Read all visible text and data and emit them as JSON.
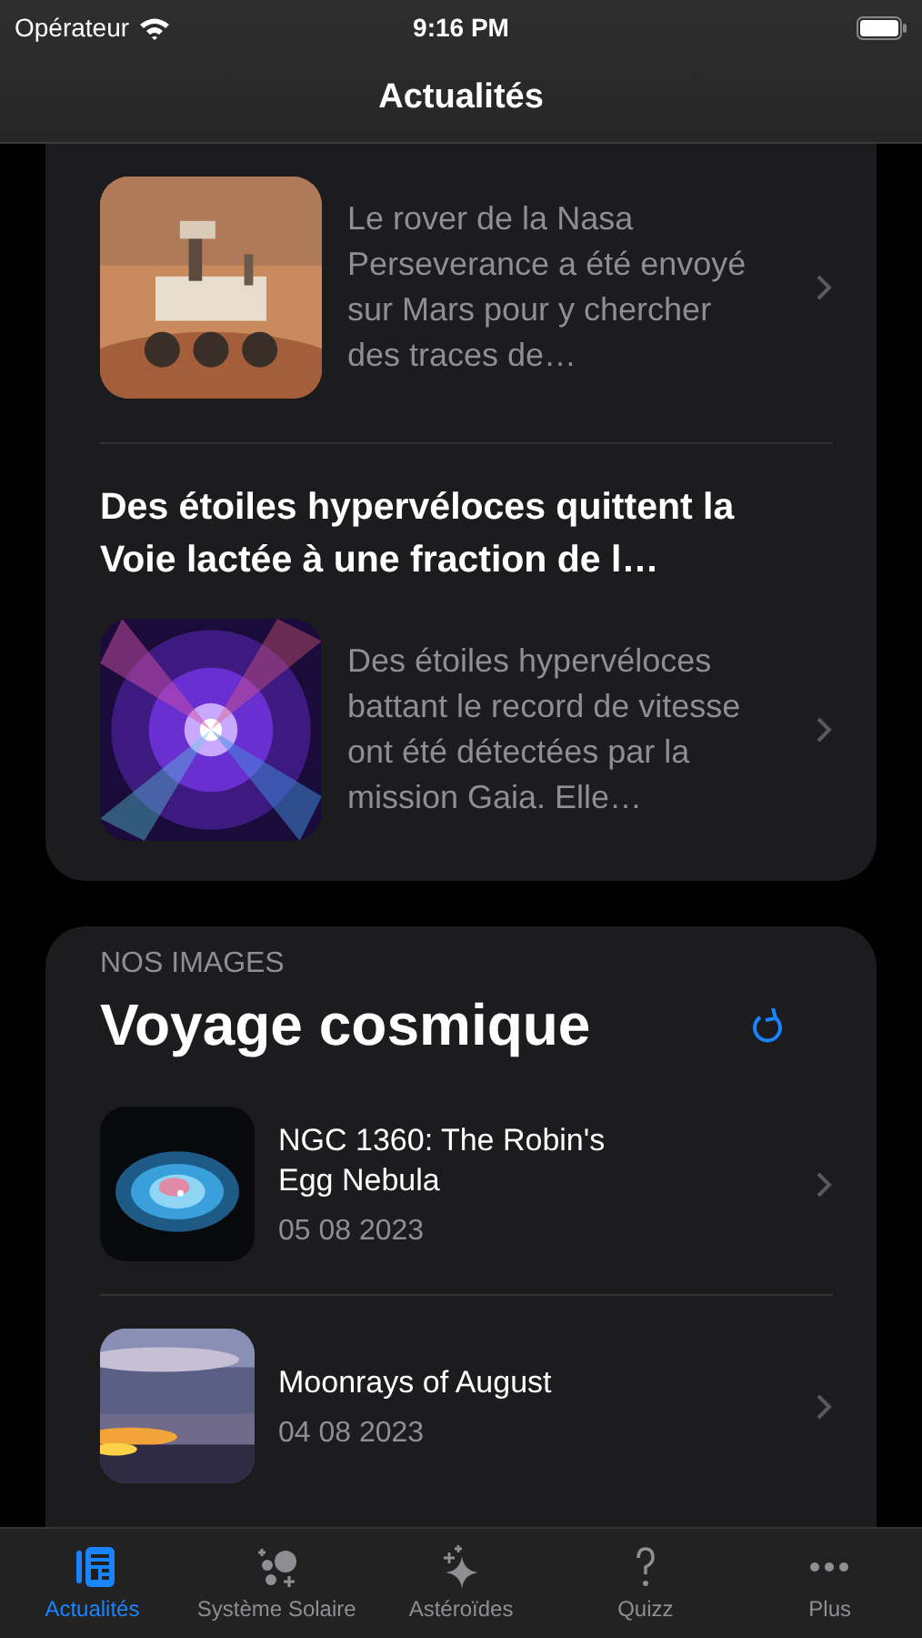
{
  "status_bar": {
    "carrier": "Opérateur",
    "time": "9:16 PM"
  },
  "nav": {
    "title": "Actualités"
  },
  "news": [
    {
      "summary": "Le rover de la Nasa Perseverance a été envoyé sur Mars pour y chercher des traces de…"
    },
    {
      "headline": "Des étoiles hypervéloces quittent la Voie lactée à une fraction de l…",
      "summary": "Des étoiles hypervéloces battant le record de vitesse ont été détectées par la mission Gaia. Elle…"
    }
  ],
  "images": {
    "overline": "NOS IMAGES",
    "title": "Voyage cosmique",
    "items": [
      {
        "title": "NGC 1360: The Robin's Egg Nebula",
        "date": "05 08 2023"
      },
      {
        "title": "Moonrays of August",
        "date": "04 08 2023"
      }
    ]
  },
  "tabs": [
    {
      "label": "Actualités",
      "selected": true
    },
    {
      "label": "Système Solaire",
      "selected": false
    },
    {
      "label": "Astéroïdes",
      "selected": false
    },
    {
      "label": "Quizz",
      "selected": false
    },
    {
      "label": "Plus",
      "selected": false
    }
  ]
}
